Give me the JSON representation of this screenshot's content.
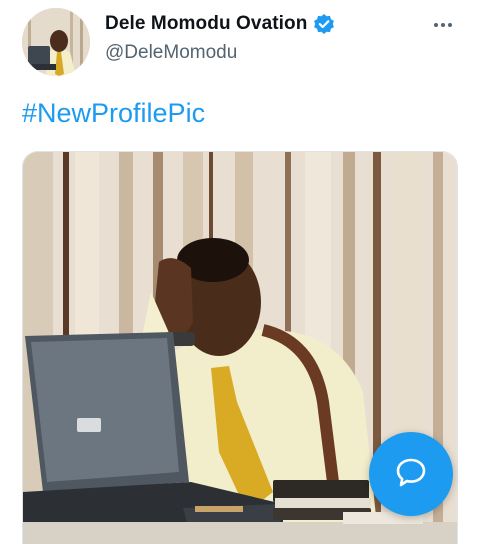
{
  "tweet": {
    "display_name": "Dele Momodu Ovation",
    "handle": "@DeleMomodu",
    "text": "#NewProfilePic",
    "verified": true
  },
  "icons": {
    "verified": "verified-badge-icon",
    "more": "more-options-icon",
    "compose": "compose-reply-icon"
  },
  "colors": {
    "accent": "#1d9bf0",
    "name": "#0f1419",
    "secondary": "#536471"
  }
}
